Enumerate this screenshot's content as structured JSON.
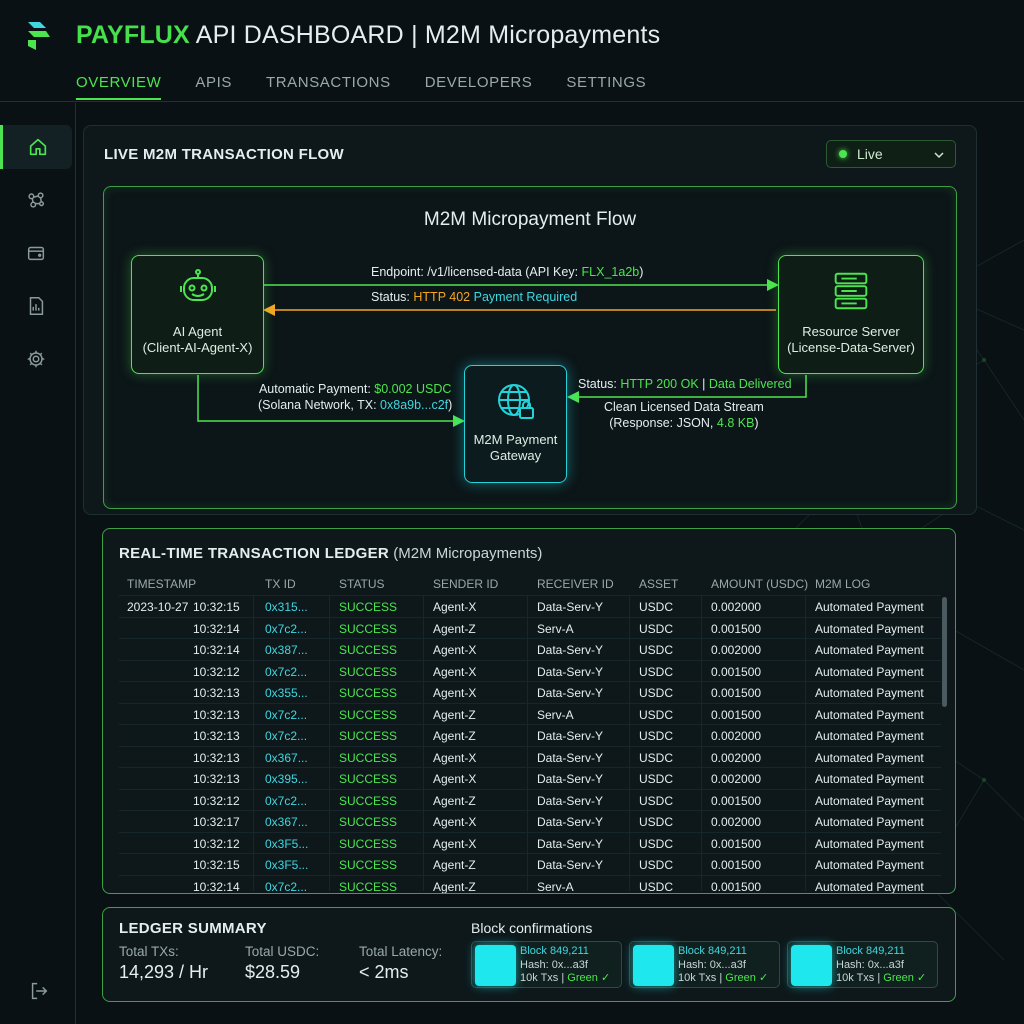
{
  "header": {
    "brand": "PAYFLUX",
    "title": "API DASHBOARD | M2M Micropayments"
  },
  "nav": {
    "tabs": [
      {
        "label": "OVERVIEW",
        "active": true
      },
      {
        "label": "APIS"
      },
      {
        "label": "TRANSACTIONS"
      },
      {
        "label": "DEVELOPERS"
      },
      {
        "label": "SETTINGS"
      }
    ]
  },
  "sidebar": {
    "icons": [
      "home-icon",
      "network-icon",
      "wallet-icon",
      "report-icon",
      "gear-icon"
    ],
    "bottom_icon": "logout-icon"
  },
  "flow_panel": {
    "title": "LIVE M2M TRANSACTION FLOW",
    "status_select": "Live",
    "diagram_title": "M2M Micropayment Flow",
    "agent": {
      "line1": "AI Agent",
      "line2": "(Client-AI-Agent-X)"
    },
    "server": {
      "line1": "Resource Server",
      "line2": "(License-Data-Server)"
    },
    "gateway": {
      "line1": "M2M Payment",
      "line2": "Gateway"
    },
    "request": {
      "prefix": "Endpoint: /v1/licensed-data (API Key: ",
      "key": "FLX_1a2b",
      "suffix": ")"
    },
    "status402": {
      "prefix": "Status: ",
      "code": "HTTP 402",
      "msg": "Payment Required"
    },
    "payment": {
      "prefix": "Automatic Payment: ",
      "amount": "$0.002 USDC",
      "line2_prefix": "(Solana Network, TX: ",
      "tx": "0x8a9b...c2f",
      "line2_suffix": ")"
    },
    "status200": {
      "prefix": "Status: ",
      "code": "HTTP 200 OK",
      "sep": " | ",
      "msg": "Data Delivered"
    },
    "stream": {
      "line1": "Clean Licensed Data Stream",
      "line2_prefix": "(Response: JSON, ",
      "size": "4.8 KB",
      "line2_suffix": ")"
    },
    "colors": {
      "green": "#4ce54f",
      "orange": "#f5a623",
      "cyan": "#3fd7e0"
    }
  },
  "ledger": {
    "title_bold": "REAL-TIME TRANSACTION LEDGER",
    "title_rest": " (M2M Micropayments)",
    "columns": [
      "TIMESTAMP",
      "TX ID",
      "STATUS",
      "SENDER ID",
      "RECEIVER ID",
      "ASSET",
      "AMOUNT (USDC)",
      "M2M LOG"
    ],
    "rows": [
      {
        "date": "2023-10-27",
        "time": "10:32:15",
        "tx": "0x315...",
        "status": "SUCCESS",
        "sender": "Agent-X",
        "receiver": "Data-Serv-Y",
        "asset": "USDC",
        "amount": "0.002000",
        "log": "Automated Payment"
      },
      {
        "date": "",
        "time": "10:32:14",
        "tx": "0x7c2...",
        "status": "SUCCESS",
        "sender": "Agent-Z",
        "receiver": "Serv-A",
        "asset": "USDC",
        "amount": "0.001500",
        "log": "Automated Payment"
      },
      {
        "date": "",
        "time": "10:32:14",
        "tx": "0x387...",
        "status": "SUCCESS",
        "sender": "Agent-X",
        "receiver": "Data-Serv-Y",
        "asset": "USDC",
        "amount": "0.002000",
        "log": "Automated Payment"
      },
      {
        "date": "",
        "time": "10:32:12",
        "tx": "0x7c2...",
        "status": "SUCCESS",
        "sender": "Agent-X",
        "receiver": "Data-Serv-Y",
        "asset": "USDC",
        "amount": "0.001500",
        "log": "Automated Payment"
      },
      {
        "date": "",
        "time": "10:32:13",
        "tx": "0x355...",
        "status": "SUCCESS",
        "sender": "Agent-X",
        "receiver": "Data-Serv-Y",
        "asset": "USDC",
        "amount": "0.001500",
        "log": "Automated Payment"
      },
      {
        "date": "",
        "time": "10:32:13",
        "tx": "0x7c2...",
        "status": "SUCCESS",
        "sender": "Agent-Z",
        "receiver": "Serv-A",
        "asset": "USDC",
        "amount": "0.001500",
        "log": "Automated Payment"
      },
      {
        "date": "",
        "time": "10:32:13",
        "tx": "0x7c2...",
        "status": "SUCCESS",
        "sender": "Agent-Z",
        "receiver": "Data-Serv-Y",
        "asset": "USDC",
        "amount": "0.002000",
        "log": "Automated Payment"
      },
      {
        "date": "",
        "time": "10:32:13",
        "tx": "0x367...",
        "status": "SUCCESS",
        "sender": "Agent-X",
        "receiver": "Data-Serv-Y",
        "asset": "USDC",
        "amount": "0.002000",
        "log": "Automated Payment"
      },
      {
        "date": "",
        "time": "10:32:13",
        "tx": "0x395...",
        "status": "SUCCESS",
        "sender": "Agent-X",
        "receiver": "Data-Serv-Y",
        "asset": "USDC",
        "amount": "0.002000",
        "log": "Automated Payment"
      },
      {
        "date": "",
        "time": "10:32:12",
        "tx": "0x7c2...",
        "status": "SUCCESS",
        "sender": "Agent-Z",
        "receiver": "Data-Serv-Y",
        "asset": "USDC",
        "amount": "0.001500",
        "log": "Automated Payment"
      },
      {
        "date": "",
        "time": "10:32:17",
        "tx": "0x367...",
        "status": "SUCCESS",
        "sender": "Agent-X",
        "receiver": "Data-Serv-Y",
        "asset": "USDC",
        "amount": "0.002000",
        "log": "Automated Payment"
      },
      {
        "date": "",
        "time": "10:32:12",
        "tx": "0x3F5...",
        "status": "SUCCESS",
        "sender": "Agent-X",
        "receiver": "Data-Serv-Y",
        "asset": "USDC",
        "amount": "0.001500",
        "log": "Automated Payment"
      },
      {
        "date": "",
        "time": "10:32:15",
        "tx": "0x3F5...",
        "status": "SUCCESS",
        "sender": "Agent-Z",
        "receiver": "Data-Serv-Y",
        "asset": "USDC",
        "amount": "0.001500",
        "log": "Automated Payment"
      },
      {
        "date": "",
        "time": "10:32:14",
        "tx": "0x7c2...",
        "status": "SUCCESS",
        "sender": "Agent-Z",
        "receiver": "Serv-A",
        "asset": "USDC",
        "amount": "0.001500",
        "log": "Automated Payment"
      }
    ]
  },
  "summary": {
    "title": "LEDGER SUMMARY",
    "stats": [
      {
        "label": "Total TXs:",
        "value": "14,293 / Hr"
      },
      {
        "label": "Total USDC:",
        "value": "$28.59"
      },
      {
        "label": "Total Latency:",
        "value": "< 2ms"
      }
    ],
    "blocks_title": "Block confirmations",
    "blocks": [
      {
        "block": "Block 849,211",
        "hash": "Hash: 0x...a3f",
        "txs": "10k Txs | ",
        "state": "Green",
        "check": "✓"
      },
      {
        "block": "Block 849,211",
        "hash": "Hash: 0x...a3f",
        "txs": "10k Txs | ",
        "state": "Green",
        "check": "✓"
      },
      {
        "block": "Block 849,211",
        "hash": "Hash: 0x...a3f",
        "txs": "10k Txs | ",
        "state": "Green",
        "check": "✓"
      }
    ]
  }
}
